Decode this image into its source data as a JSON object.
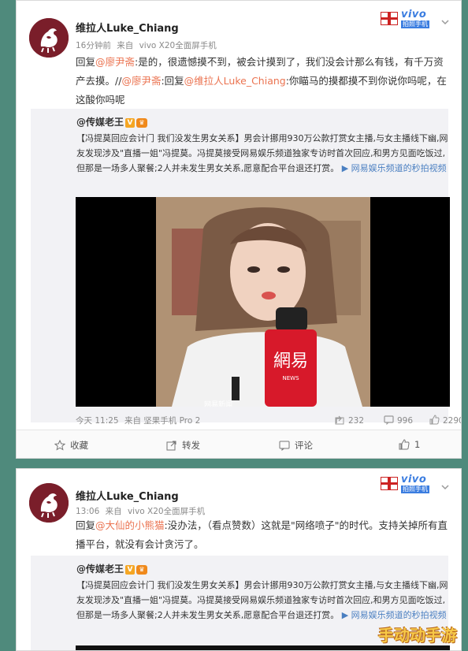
{
  "posts": [
    {
      "username": "维拉人Luke_Chiang",
      "time": "16分钟前",
      "source_prefix": "来自",
      "source": "vivo X20全面屏手机",
      "text_parts": [
        {
          "t": "回复"
        },
        {
          "t": "@廖尹斋",
          "mention": true
        },
        {
          "t": ":是的，很遗憾摸不到，被会计摸到了，我们没会计那么有钱，有千万资产去摸。//"
        },
        {
          "t": "@廖尹斋",
          "mention": true
        },
        {
          "t": ":回复"
        },
        {
          "t": "@维拉人Luke_Chiang",
          "mention": true
        },
        {
          "t": ":你瞄马的摸都摸不到你说你吗呢，在这酸你吗呢"
        }
      ],
      "repost": {
        "user": "@传媒老王",
        "text": "【冯提莫回应会计门 我们没发生男女关系】男会计挪用930万公款打赏女主播,与女主播线下幽,网友发现涉及\"直播一姐\"冯提莫。冯提莫接受网易娱乐频道独家专访时首次回应,和男方见面吃饭过,但那是一场多人聚餐;2人并未发生男女关系,愿意配合平台退还打赏。",
        "link_text": "网易娱乐频道的秒拍视频"
      },
      "video_overlay_label": "网易新闻",
      "foot_time": "今天 11:25",
      "foot_source": "来自 坚果手机 Pro 2",
      "stats": {
        "repost": "232",
        "comment": "996",
        "like": "2290"
      },
      "actions": {
        "favorite": "收藏",
        "forward": "转发",
        "comment": "评论",
        "like": "1"
      }
    },
    {
      "username": "维拉人Luke_Chiang",
      "time": "13:06",
      "source_prefix": "来自",
      "source": "vivo X20全面屏手机",
      "text_parts": [
        {
          "t": "回复"
        },
        {
          "t": "@大仙的小熊猫",
          "mention": true
        },
        {
          "t": ":没办法，（看点赞数）这就是\"网络喷子\"的时代。支持关掉所有直播平台，就没有会计贪污了。"
        }
      ],
      "repost": {
        "user": "@传媒老王",
        "text": "【冯提莫回应会计门 我们没发生男女关系】男会计挪用930万公款打赏女主播,与女主播线下幽,网友发现涉及\"直播一姐\"冯提莫。冯提莫接受网易娱乐频道独家专访时首次回应,和男方见面吃饭过,但那是一场多人聚餐;2人并未发生男女关系,愿意配合平台退还打赏。",
        "link_text": "网易娱乐频道的秒拍视频"
      }
    }
  ],
  "badge": {
    "brand": "vivo",
    "sub": "拍照手机"
  },
  "watermark": "手动动手游",
  "colors": {
    "mention": "#eb7350",
    "link": "#4a7fc1",
    "vivo": "#3b7de0",
    "background": "#4f8a7c"
  },
  "icons": {
    "avatar": "griffin-crest-icon",
    "dropdown": "chevron-down-icon",
    "repost": "share-icon",
    "comment": "comment-icon",
    "like": "thumbs-up-icon",
    "favorite": "star-icon"
  }
}
